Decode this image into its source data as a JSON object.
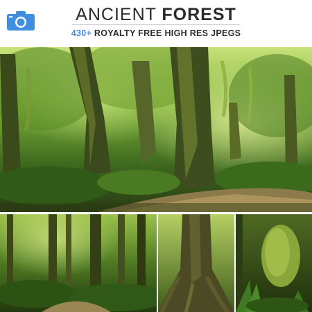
{
  "header": {
    "icon": "camera-icon",
    "accent_color": "#3f8ee0",
    "title_light": "ANCIENT ",
    "title_bold": "FOREST",
    "subtitle_accent": "430+",
    "subtitle_rest": " ROYALTY FREE HIGH RES JPEGS"
  },
  "photos": [
    {
      "subject": "mossy forest path with sunlit trees"
    },
    {
      "subject": "fern forest with tall trunks"
    },
    {
      "subject": "tree roots close-up"
    },
    {
      "subject": "moss-covered stump and ferns"
    }
  ]
}
